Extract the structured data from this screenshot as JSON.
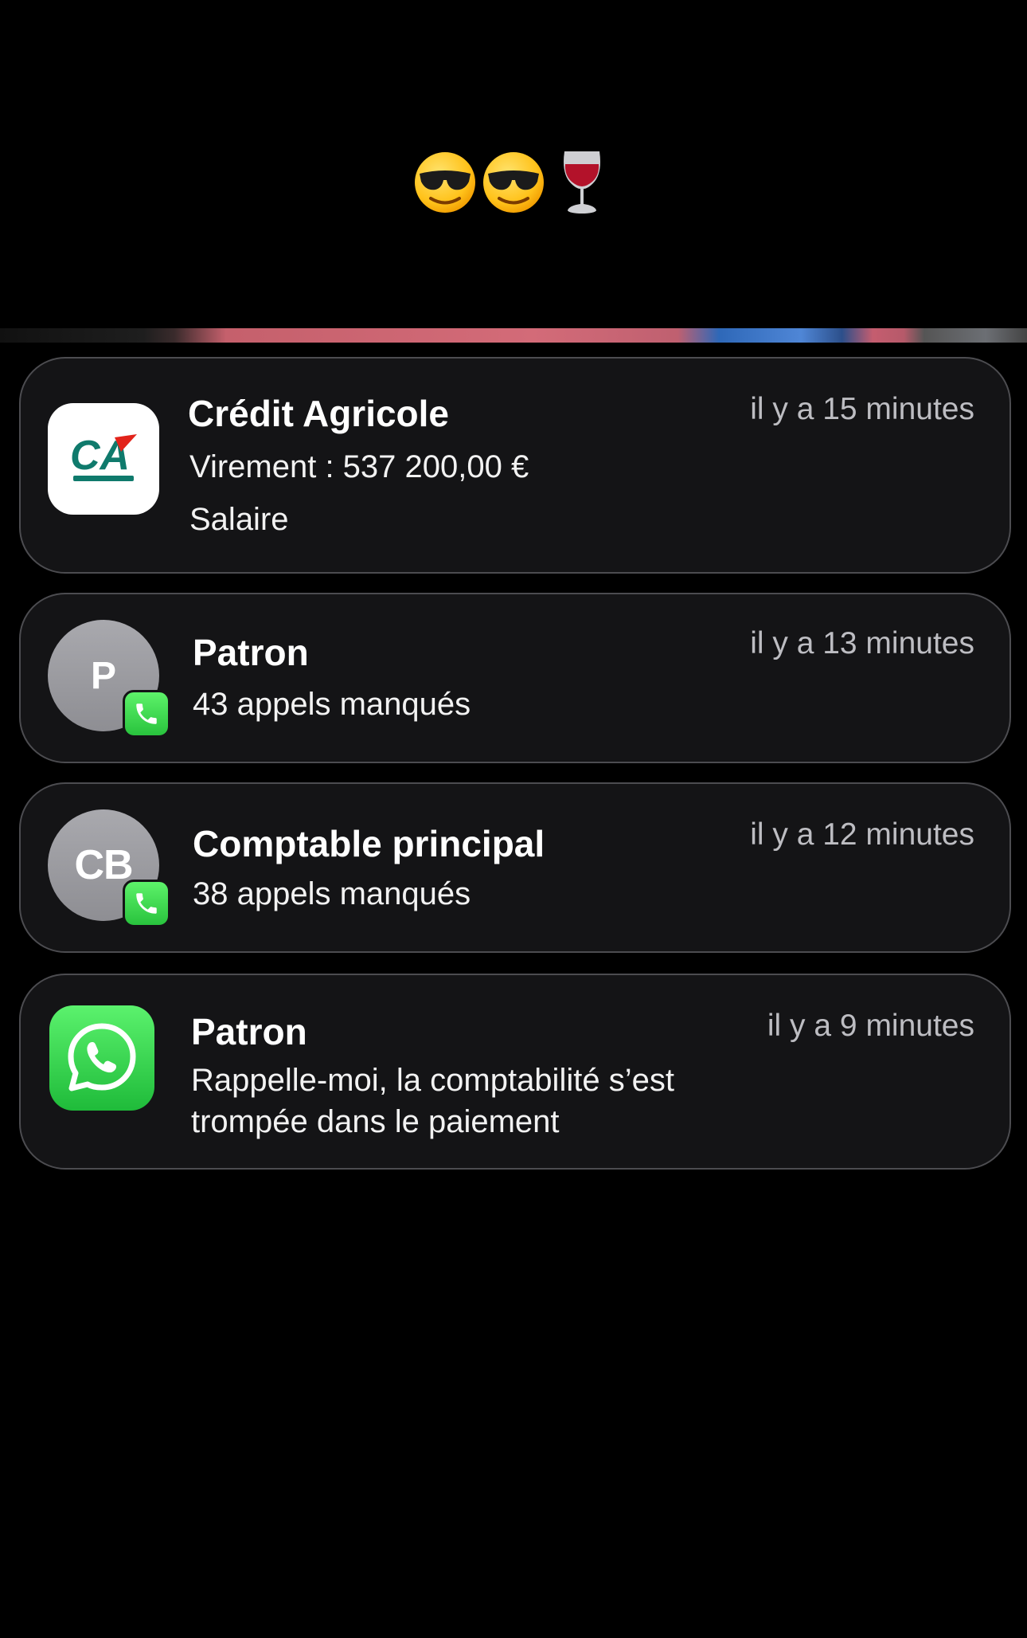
{
  "caption": {
    "emojis": [
      "smiling-face-with-sunglasses",
      "smiling-face-with-sunglasses",
      "wine-glass"
    ]
  },
  "notifications": [
    {
      "app_icon": "credit-agricole-logo",
      "title": "Crédit Agricole",
      "lines": [
        "Virement : 537 200,00 €",
        "Salaire"
      ],
      "time": "il y a 15 minutes"
    },
    {
      "app_icon": "phone-icon",
      "avatar_initials": "P",
      "title": "Patron",
      "lines": [
        "43 appels manqués"
      ],
      "time": "il y a 13 minutes"
    },
    {
      "app_icon": "phone-icon",
      "avatar_initials": "CB",
      "title": "Comptable principal",
      "lines": [
        "38 appels manqués"
      ],
      "time": "il y a 12 minutes"
    },
    {
      "app_icon": "whatsapp-icon",
      "title": "Patron",
      "lines": [
        "Rappelle-moi, la comptabilité s’est",
        "trompée dans le paiement"
      ],
      "time": "il y a 9 minutes"
    }
  ],
  "colors": {
    "background": "#000000",
    "card": "#141416",
    "card_border": "#4c4c50",
    "time_text": "#bdbdc2",
    "credit_agricole_green": "#0f7a6c",
    "credit_agricole_red": "#e2231a",
    "phone_green": "#34c759",
    "whatsapp_green": "#25d366"
  }
}
